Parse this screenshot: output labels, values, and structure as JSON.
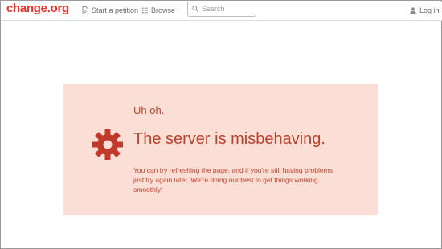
{
  "brand": {
    "logo_text": "change.org",
    "color": "#e8322a"
  },
  "nav": {
    "start_petition": {
      "label": "Start a petition",
      "icon": "document-icon"
    },
    "browse": {
      "label": "Browse",
      "icon": "list-icon"
    },
    "search": {
      "placeholder": "Search",
      "value": "",
      "icon": "search-icon"
    },
    "login": {
      "label": "Log in",
      "icon": "user-icon"
    }
  },
  "error": {
    "icon": "gear-icon",
    "title": "Uh oh.",
    "headline": "The server is misbehaving.",
    "message": "You can try refreshing the page, and if you're still having problems, just try again later. We're doing our best to get things working smoothly!",
    "accent_color": "#c0392b",
    "background_color": "#fbdfd6"
  }
}
